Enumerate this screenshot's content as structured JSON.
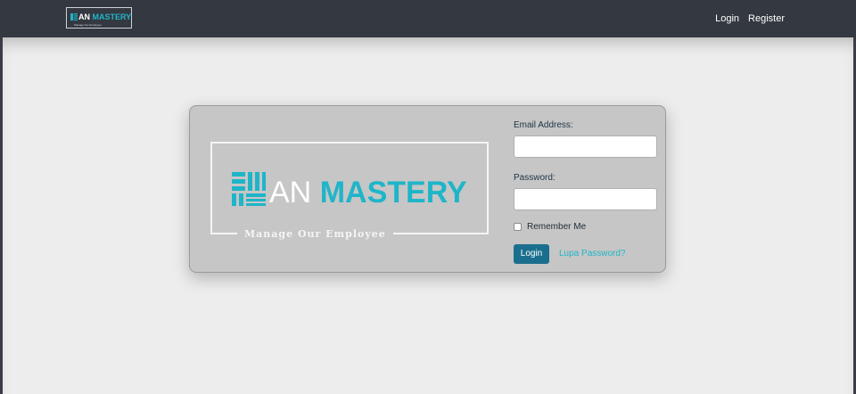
{
  "navbar": {
    "brand": {
      "an": "AN",
      "mastery": "MASTERY",
      "tagline": "Manage Our Employee"
    },
    "links": {
      "login": "Login",
      "register": "Register"
    }
  },
  "card": {
    "logo": {
      "an": "AN",
      "mastery": "MASTERY",
      "tagline": "Manage Our Employee"
    },
    "form": {
      "email_label": "Email Address:",
      "email_value": "",
      "password_label": "Password:",
      "password_value": "",
      "remember_label": "Remember Me",
      "remember_checked": false,
      "login_button": "Login",
      "forgot_link": "Lupa Password?"
    }
  },
  "colors": {
    "navbar": "#343840",
    "accent": "#1fb5c8",
    "button": "#1b6f8e",
    "card": "#c6c6c6",
    "page": "#ededed"
  },
  "icons": {
    "logo_mark": "stacked-lines-logo-icon"
  }
}
